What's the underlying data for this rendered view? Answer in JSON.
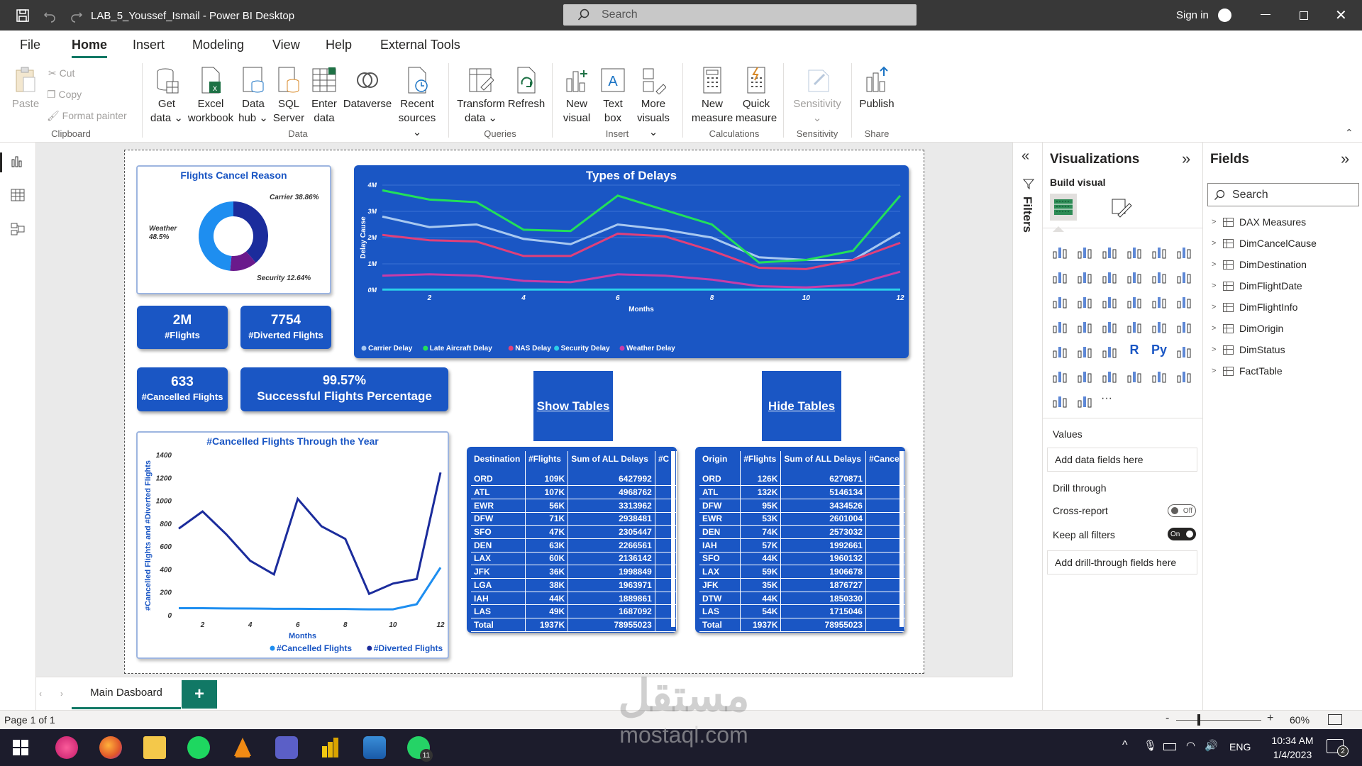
{
  "window": {
    "title": "LAB_5_Youssef_Ismail - Power BI Desktop",
    "search_placeholder": "Search",
    "sign_in": "Sign in"
  },
  "tabs": [
    "File",
    "Home",
    "Insert",
    "Modeling",
    "View",
    "Help",
    "External Tools"
  ],
  "ribbon": {
    "clipboard": {
      "paste": "Paste",
      "cut": "Cut",
      "copy": "Copy",
      "format_painter": "Format painter",
      "label": "Clipboard"
    },
    "data": {
      "get_data": [
        "Get",
        "data"
      ],
      "excel": [
        "Excel",
        "workbook"
      ],
      "data_hub": [
        "Data",
        "hub"
      ],
      "sql": [
        "SQL",
        "Server"
      ],
      "enter": [
        "Enter",
        "data"
      ],
      "dataverse": "Dataverse",
      "recent": [
        "Recent",
        "sources"
      ],
      "label": "Data"
    },
    "queries": {
      "transform": [
        "Transform",
        "data"
      ],
      "refresh": "Refresh",
      "label": "Queries"
    },
    "insert": {
      "new_visual": [
        "New",
        "visual"
      ],
      "text_box": [
        "Text",
        "box"
      ],
      "more_visuals": [
        "More",
        "visuals"
      ],
      "label": "Insert"
    },
    "calculations": {
      "new_measure": [
        "New",
        "measure"
      ],
      "quick_measure": [
        "Quick",
        "measure"
      ],
      "label": "Calculations"
    },
    "sensitivity": {
      "btn": "Sensitivity",
      "label": "Sensitivity"
    },
    "share": {
      "publish": "Publish",
      "label": "Share"
    }
  },
  "report": {
    "donut": {
      "title": "Flights Cancel Reason",
      "slices": [
        {
          "name": "Carrier",
          "pct": 38.86,
          "label": "Carrier 38.86%",
          "color": "#1b2c9c"
        },
        {
          "name": "Security",
          "pct": 12.64,
          "label": "Security 12.64%",
          "color": "#6a1a8c"
        },
        {
          "name": "Weather",
          "pct": 48.5,
          "label": "Weather 48.5%",
          "color": "#1e8ef0"
        }
      ]
    },
    "kpis": [
      {
        "value": "2M",
        "label": "#Flights"
      },
      {
        "value": "7754",
        "label": "#Diverted Flights"
      },
      {
        "value": "633",
        "label": "#Cancelled Flights"
      },
      {
        "value": "99.57%",
        "label": "Successful Flights Percentage"
      }
    ],
    "show_tables": "Show Tables",
    "hide_tables": "Hide Tables",
    "delays_chart": {
      "title": "Types of Delays",
      "xlabel": "Months",
      "ylabel": "Delay Cause",
      "x": [
        1,
        2,
        3,
        4,
        5,
        6,
        7,
        8,
        9,
        10,
        11,
        12
      ],
      "yticks": [
        "0M",
        "1M",
        "2M",
        "3M",
        "4M"
      ],
      "xticks": [
        2,
        4,
        6,
        8,
        10,
        12
      ],
      "series": [
        {
          "name": "Carrier Delay",
          "color": "#a8c8f0",
          "values": [
            2.8,
            2.4,
            2.5,
            1.95,
            1.75,
            2.5,
            2.3,
            2.0,
            1.25,
            1.15,
            1.15,
            2.2
          ]
        },
        {
          "name": "Late Aircraft Delay",
          "color": "#22e05a",
          "values": [
            3.8,
            3.45,
            3.35,
            2.3,
            2.25,
            3.6,
            3.05,
            2.5,
            1.05,
            1.15,
            1.5,
            3.6
          ]
        },
        {
          "name": "NAS Delay",
          "color": "#e0407a",
          "values": [
            2.1,
            1.9,
            1.85,
            1.3,
            1.3,
            2.15,
            2.05,
            1.5,
            0.85,
            0.8,
            1.15,
            1.8
          ]
        },
        {
          "name": "Security Delay",
          "color": "#2ad0e8",
          "values": [
            0.02,
            0.02,
            0.02,
            0.02,
            0.02,
            0.02,
            0.02,
            0.02,
            0.02,
            0.02,
            0.02,
            0.02
          ]
        },
        {
          "name": "Weather Delay",
          "color": "#c83ca8",
          "values": [
            0.55,
            0.6,
            0.55,
            0.35,
            0.3,
            0.6,
            0.55,
            0.4,
            0.15,
            0.1,
            0.2,
            0.7
          ]
        }
      ]
    },
    "cancel_chart": {
      "title": "#Cancelled Flights Through the Year",
      "xlabel": "Months",
      "ylabel": "#Cancelled Flights and #Diverted Flights",
      "yticks": [
        0,
        200,
        400,
        600,
        800,
        1000,
        1200,
        1400
      ],
      "xticks": [
        2,
        4,
        6,
        8,
        10,
        12
      ],
      "x": [
        1,
        2,
        3,
        4,
        5,
        6,
        7,
        8,
        9,
        10,
        11,
        12
      ],
      "series": [
        {
          "name": "#Cancelled Flights",
          "color": "#1e8ef0",
          "values": [
            65,
            65,
            63,
            62,
            60,
            60,
            58,
            58,
            55,
            55,
            100,
            420
          ]
        },
        {
          "name": "#Diverted Flights",
          "color": "#1b2c9c",
          "values": [
            760,
            910,
            710,
            480,
            360,
            1020,
            780,
            670,
            190,
            280,
            320,
            1250
          ]
        }
      ]
    },
    "dest_table": {
      "headers": [
        "Destination",
        "#Flights",
        "Sum of ALL Delays",
        "#C"
      ],
      "rows": [
        [
          "ORD",
          "109K",
          "6427992"
        ],
        [
          "ATL",
          "107K",
          "4968762"
        ],
        [
          "EWR",
          "56K",
          "3313962"
        ],
        [
          "DFW",
          "71K",
          "2938481"
        ],
        [
          "SFO",
          "47K",
          "2305447"
        ],
        [
          "DEN",
          "63K",
          "2266561"
        ],
        [
          "LAX",
          "60K",
          "2136142"
        ],
        [
          "JFK",
          "36K",
          "1998849"
        ],
        [
          "LGA",
          "38K",
          "1963971"
        ],
        [
          "IAH",
          "44K",
          "1889861"
        ],
        [
          "LAS",
          "49K",
          "1687092"
        ]
      ],
      "total": [
        "Total",
        "1937K",
        "78955023"
      ]
    },
    "origin_table": {
      "headers": [
        "Origin",
        "#Flights",
        "Sum of ALL Delays",
        "#Cancel"
      ],
      "rows": [
        [
          "ORD",
          "126K",
          "6270871"
        ],
        [
          "ATL",
          "132K",
          "5146134"
        ],
        [
          "DFW",
          "95K",
          "3434526"
        ],
        [
          "EWR",
          "53K",
          "2601004"
        ],
        [
          "DEN",
          "74K",
          "2573032"
        ],
        [
          "IAH",
          "57K",
          "1992661"
        ],
        [
          "SFO",
          "44K",
          "1960132"
        ],
        [
          "LAX",
          "59K",
          "1906678"
        ],
        [
          "JFK",
          "35K",
          "1876727"
        ],
        [
          "DTW",
          "44K",
          "1850330"
        ],
        [
          "LAS",
          "54K",
          "1715046"
        ]
      ],
      "total": [
        "Total",
        "1937K",
        "78955023"
      ]
    }
  },
  "filters_label": "Filters",
  "visualizations": {
    "title": "Visualizations",
    "build_visual": "Build visual",
    "values": "Values",
    "add_data": "Add data fields here",
    "drill_through": "Drill through",
    "cross_report": "Cross-report",
    "cross_state": "Off",
    "keep_filters": "Keep all filters",
    "keep_state": "On",
    "add_drill": "Add drill-through fields here"
  },
  "fields": {
    "title": "Fields",
    "search_placeholder": "Search",
    "items": [
      "DAX Measures",
      "DimCancelCause",
      "DimDestination",
      "DimFlightDate",
      "DimFlightInfo",
      "DimOrigin",
      "DimStatus",
      "FactTable"
    ]
  },
  "page_tab": "Main Dasboard",
  "status": {
    "page": "Page 1 of 1",
    "zoom": "60%"
  },
  "taskbar": {
    "lang": "ENG",
    "time": "10:34 AM",
    "date": "1/4/2023",
    "whatsapp_badge": "11",
    "notif": "2"
  },
  "watermark": {
    "arabic": "مستقل",
    "latin": "mostaql.com"
  }
}
